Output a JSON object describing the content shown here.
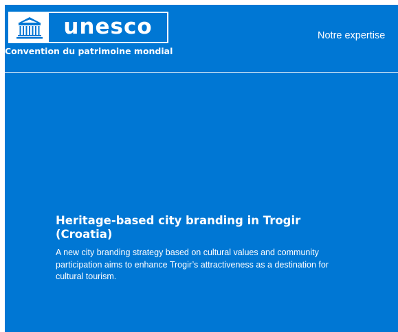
{
  "colors": {
    "brand_blue": "#0077d4",
    "text": "#ffffff"
  },
  "header": {
    "logo_icon": "unesco-temple-emblem",
    "logo_text": "unesco",
    "subtitle": "Convention du patrimoine mondial",
    "nav": {
      "expertise_label": "Notre expertise"
    }
  },
  "hero": {
    "title": "Heritage-based city branding in Trogir (Croatia)",
    "description": "A new city branding strategy based on cultural values and community participation aims to enhance Trogir’s attractiveness as a destination for cultural tourism."
  }
}
